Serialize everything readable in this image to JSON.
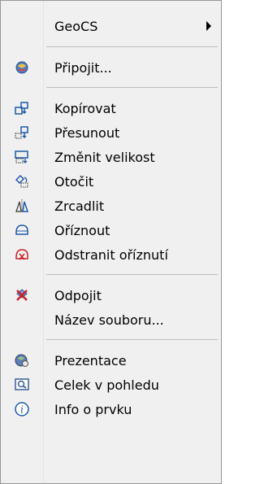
{
  "menu": {
    "items": [
      {
        "id": "geocs",
        "label": "GeoCS",
        "icon": "none",
        "submenu": true
      },
      {
        "id": "pripojit",
        "label": "Připojit...",
        "icon": "connect-icon"
      },
      {
        "id": "kopirovat",
        "label": "Kopírovat",
        "icon": "copy-icon"
      },
      {
        "id": "presunout",
        "label": "Přesunout",
        "icon": "move-icon"
      },
      {
        "id": "zmenit-velikost",
        "label": "Změnit velikost",
        "icon": "resize-icon"
      },
      {
        "id": "otocit",
        "label": "Otočit",
        "icon": "rotate-icon"
      },
      {
        "id": "zrcadlit",
        "label": "Zrcadlit",
        "icon": "mirror-icon"
      },
      {
        "id": "oriznout",
        "label": "Oříznout",
        "icon": "clip-icon"
      },
      {
        "id": "odstranit-oriznuti",
        "label": "Odstranit oříznutí",
        "icon": "remove-clip-icon"
      },
      {
        "id": "odpojit",
        "label": "Odpojit",
        "icon": "disconnect-icon"
      },
      {
        "id": "nazev-souboru",
        "label": "Název souboru...",
        "icon": "none"
      },
      {
        "id": "prezentace",
        "label": "Prezentace",
        "icon": "presentation-icon"
      },
      {
        "id": "celek-v-pohledu",
        "label": "Celek v pohledu",
        "icon": "zoom-extents-icon"
      },
      {
        "id": "info-o-prvku",
        "label": "Info o prvku",
        "icon": "info-icon"
      }
    ]
  },
  "colors": {
    "accent_blue": "#1e5aa8",
    "accent_red": "#c8202a",
    "background": "#f0f0f0"
  }
}
